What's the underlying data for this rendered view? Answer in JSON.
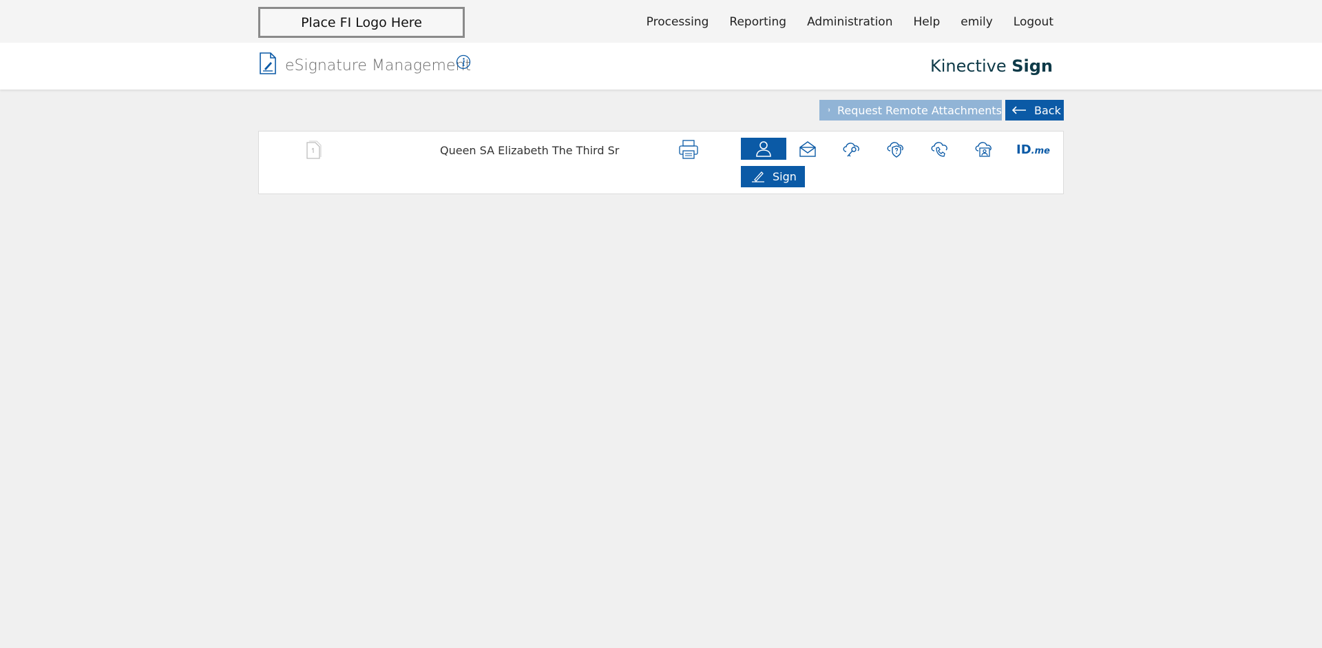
{
  "header": {
    "logo_text": "Place FI Logo Here",
    "nav": [
      "Processing",
      "Reporting",
      "Administration",
      "Help",
      "emily",
      "Logout"
    ]
  },
  "titlebar": {
    "page_title": "eSignature Management",
    "brand_regular": "Kinective",
    "brand_bold": "Sign"
  },
  "toolbar": {
    "request_attachments_label": "Request Remote Attachments",
    "back_label": "Back"
  },
  "signer": {
    "name": "Queen SA Elizabeth The Third Sr",
    "auth_methods": [
      "in-person",
      "email",
      "password",
      "security-question",
      "phone",
      "remote-id",
      "id-me"
    ],
    "idme_label_main": "ID",
    "idme_label_suffix": ".me",
    "sign_label": "Sign"
  },
  "colors": {
    "primary": "#0b5aa6",
    "primary_disabled": "#91b4d6",
    "brand_text": "#0e3a48",
    "background": "#f0f0f0"
  }
}
